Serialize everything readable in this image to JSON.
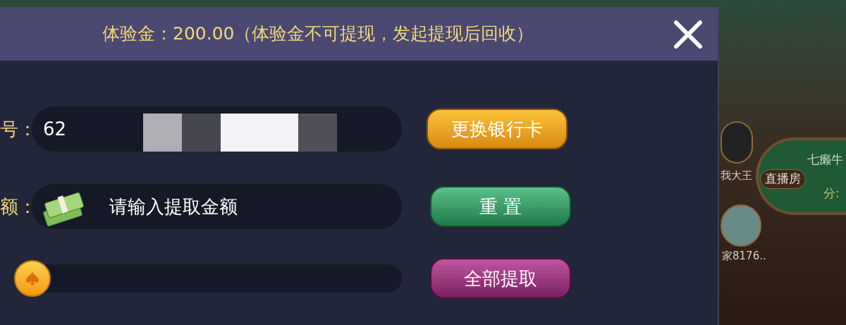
{
  "header": {
    "text": "体验金：200.00（体验金不可提现，发起提现后回收）"
  },
  "rows": [
    {
      "kind": "card",
      "label": "号：",
      "value": "62",
      "button": "更换银行卡"
    },
    {
      "kind": "amount",
      "label": "额：",
      "placeholder": "请输入提取金额",
      "button": "重 置"
    },
    {
      "kind": "slider",
      "level": 0,
      "button": "全部提取"
    }
  ],
  "background_scene": {
    "table_title": "七癞牛",
    "badge": "直播房",
    "score": "分:",
    "players": [
      "我大王",
      "家8176.."
    ]
  }
}
